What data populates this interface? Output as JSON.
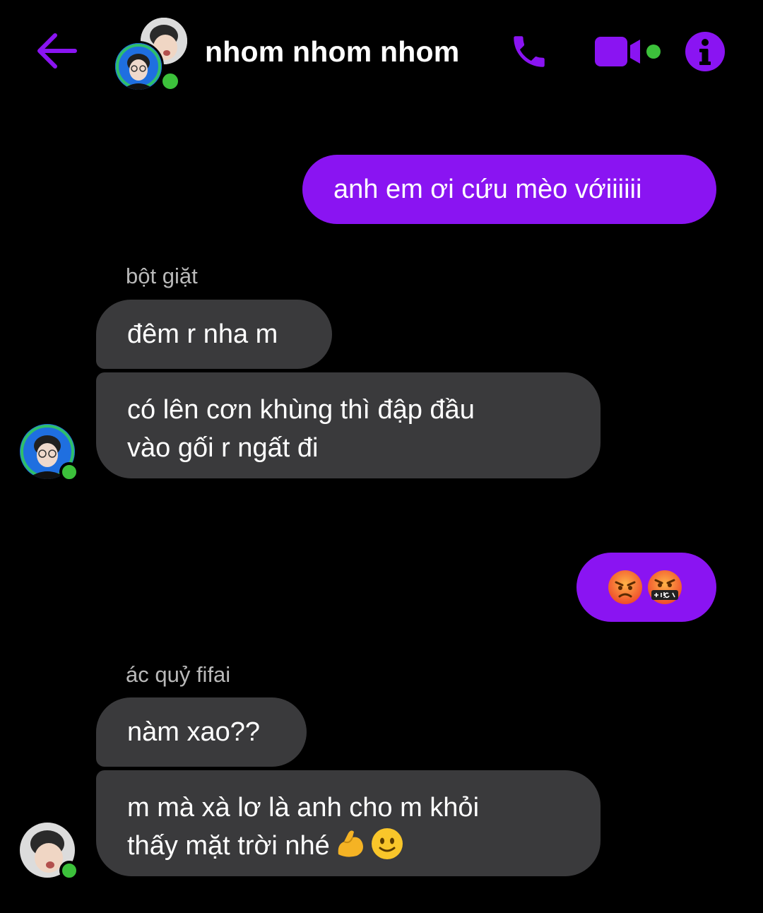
{
  "header": {
    "title": "nhom nhom nhom",
    "back_icon": "arrow-left-icon",
    "call_icon": "phone-icon",
    "video_icon": "video-camera-icon",
    "info_icon": "info-icon",
    "accent_color": "#8a14f2",
    "online_color": "#3cc13b"
  },
  "messages": [
    {
      "direction": "outgoing",
      "text": "anh em ơi cứu mèo vớiiiiii"
    },
    {
      "direction": "incoming",
      "sender": "bột giặt",
      "text": "đêm r nha m"
    },
    {
      "direction": "incoming",
      "lines": [
        "có lên cơn khùng thì đập đầu",
        "vào gối r ngất đi"
      ]
    },
    {
      "direction": "outgoing",
      "emojis": [
        "angry-face-emoji",
        "face-with-symbols-emoji"
      ]
    },
    {
      "direction": "incoming",
      "sender": "ác quỷ fifai",
      "text": "nàm xao??"
    },
    {
      "direction": "incoming",
      "lines": [
        "m mà xà lơ là anh cho m khỏi",
        "thấy mặt trời nhé"
      ],
      "emojis": [
        "flexed-biceps-emoji",
        "slightly-smiling-face-emoji"
      ]
    }
  ],
  "colors": {
    "background": "#000000",
    "incoming_bubble": "#3a3a3c",
    "outgoing_bubble": "#8a14f2",
    "sender_text": "#b9b9b9"
  }
}
